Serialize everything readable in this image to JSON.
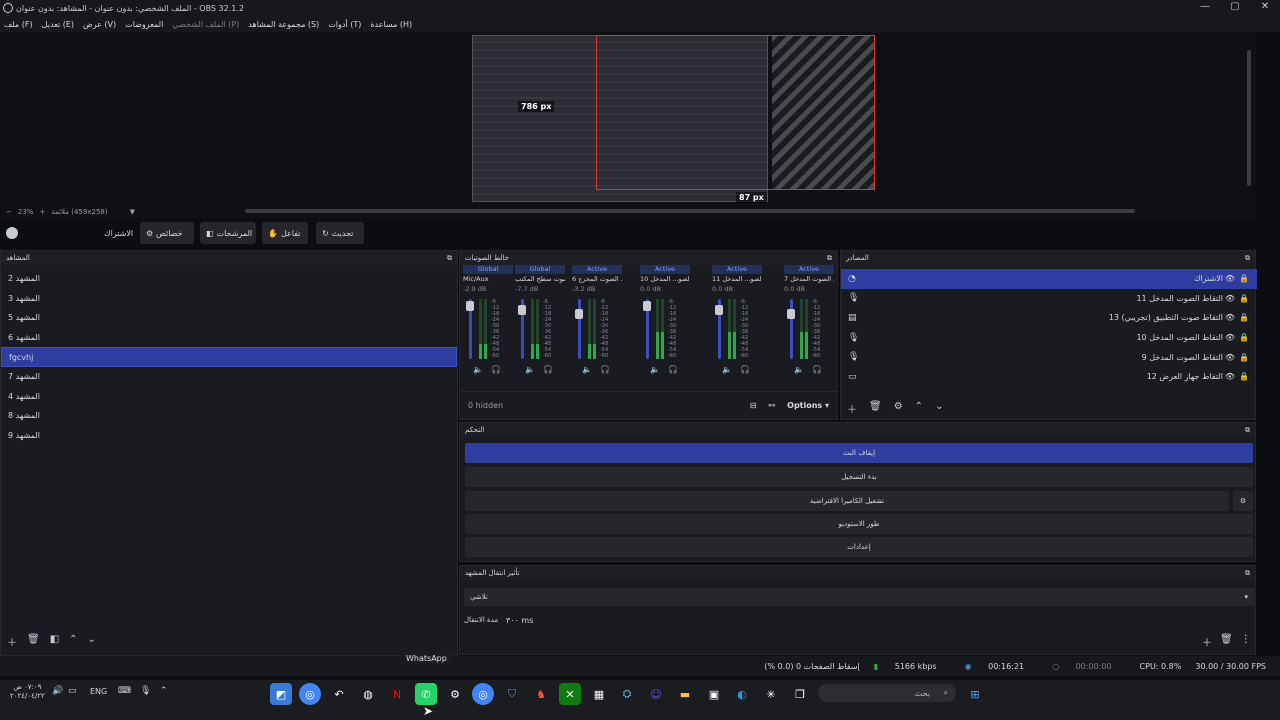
{
  "window": {
    "title": "OBS 32.1.2 - الملف الشخصي: بدون عنوان - المشاهد: بدون عنوان",
    "min": "—",
    "max": "▢",
    "close": "✕"
  },
  "menu": [
    "ملف (F)",
    "تعديل (E)",
    "عرض (V)",
    "المعروضات",
    "الملف الشخصي (P)",
    "مجموعة المشاهد (S)",
    "أدوات (T)",
    "مساعدة (H)"
  ],
  "preview": {
    "width_label": "786 px",
    "height_label": "87 px"
  },
  "zoom": {
    "minus": "−",
    "value": "23%",
    "plus": "+",
    "fit": "ملائمة (459x258)"
  },
  "toolbar": {
    "source_name": "الاشتراك",
    "properties": "خصائص",
    "filters": "المرشحات",
    "interact": "تفاعل",
    "refresh": "تحديث"
  },
  "scenes": {
    "title": "المشاهد",
    "items": [
      "المشهد 2",
      "المشهد 3",
      "المشهد 5",
      "المشهد 6",
      "fgcvhj",
      "المشهد 7",
      "المشهد 4",
      "المشهد 8",
      "المشهد 9"
    ],
    "selected": 4
  },
  "mixer": {
    "title": "خالط الصوتيات",
    "hidden": "0 hidden",
    "options": "Options",
    "channels": [
      {
        "status": "Global",
        "name": "Mic/Aux",
        "db": "-2.9 dB"
      },
      {
        "status": "Global",
        "name": "صوت سطح المكتب",
        "db": "-7.7 dB"
      },
      {
        "status": "Active",
        "name": "التقاط الصوت المخرج 6",
        "db": "-3.2 dB"
      },
      {
        "status": "Active",
        "name": "التقاط الصو... المدخل 10",
        "db": "0.0 dB"
      },
      {
        "status": "Active",
        "name": "التقاط الصو... المدخل 11",
        "db": "0.0 dB"
      },
      {
        "status": "Active",
        "name": "التقاط الصوت المدخل 7",
        "db": "0.0 dB"
      }
    ],
    "scale": [
      "-6",
      "-12",
      "-18",
      "-24",
      "-30",
      "-36",
      "-42",
      "-48",
      "-54",
      "-60"
    ]
  },
  "sources": {
    "title": "المصادر",
    "items": [
      {
        "name": "الاشتراك",
        "icon": "image-icon"
      },
      {
        "name": "التقاط الصوت المدخل 11",
        "icon": "mic-icon"
      },
      {
        "name": "التقاط صوت التطبيق (تجريبي) 13",
        "icon": "app-icon"
      },
      {
        "name": "التقاط الصوت المدخل 10",
        "icon": "mic-icon"
      },
      {
        "name": "التقاط الصوت المدخل 9",
        "icon": "mic-icon"
      },
      {
        "name": "التقاط جهاز العرض 12",
        "icon": "monitor-icon"
      }
    ],
    "selected": 0
  },
  "controls": {
    "title": "التحكم",
    "stop_stream": "إيقاف البث",
    "start_record": "بدء التسجيل",
    "virtual_cam": "تشغيل الكاميرا الافتراضية",
    "studio": "طور الاستوديو",
    "settings": "إعدادات"
  },
  "transitions": {
    "title": "تأثير انتقال المشهد",
    "type": "تلاشي",
    "duration_label": "مدة الانتقال",
    "duration": "٣٠٠ ms"
  },
  "status": {
    "dropped": "إسقاط الصفحات 0 (0.0 %)",
    "bitrate": "5166 kbps",
    "live": "00:16:21",
    "rec": "00:00:00",
    "cpu": "CPU: 0.8%",
    "fps": "30.00 / 30.00 FPS"
  },
  "taskbar": {
    "tooltip": "WhatsApp",
    "search": "بحث",
    "lang": "ENG",
    "time": "٠٧:٠٩ ص",
    "date": "٢٠٢٤/٠٤/٢٢"
  },
  "colors": {
    "accent": "#2f3da0",
    "record": "#d33333",
    "meter": "#2fa84a"
  }
}
